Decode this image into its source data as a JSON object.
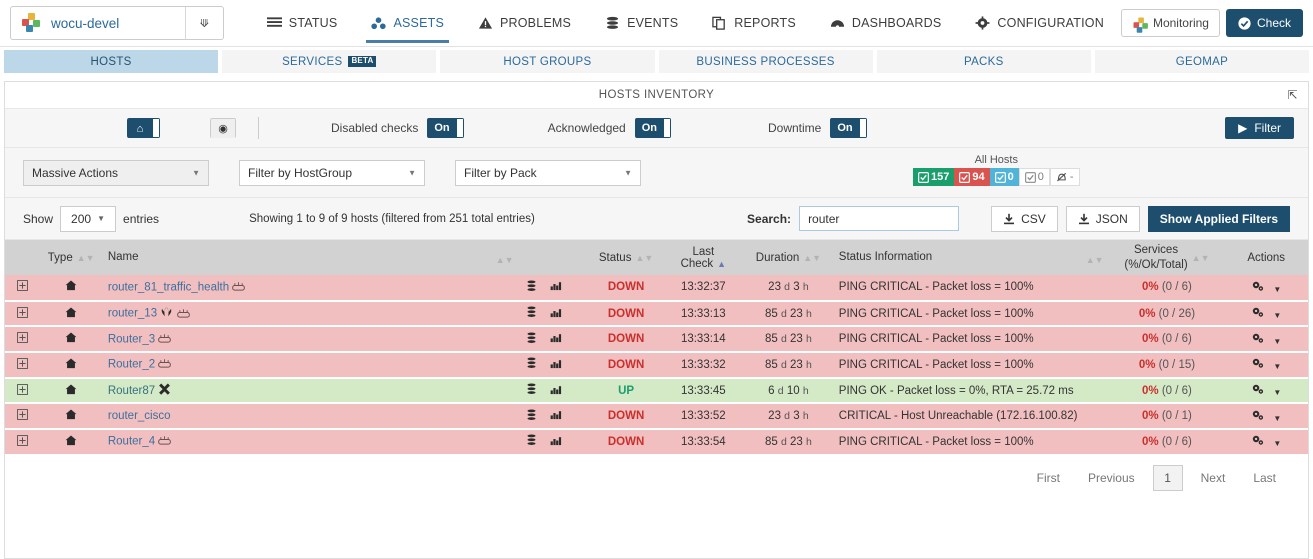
{
  "topnav": {
    "org_name": "wocu-devel",
    "items": [
      {
        "label": "STATUS",
        "icon": "list-icon",
        "active": false
      },
      {
        "label": "ASSETS",
        "icon": "assets-icon",
        "active": true
      },
      {
        "label": "PROBLEMS",
        "icon": "warning-triangle-icon",
        "active": false
      },
      {
        "label": "EVENTS",
        "icon": "stack-icon",
        "active": false
      },
      {
        "label": "REPORTS",
        "icon": "copy-icon",
        "active": false
      },
      {
        "label": "DASHBOARDS",
        "icon": "dashboard-icon",
        "active": false
      },
      {
        "label": "CONFIGURATION",
        "icon": "gear-icon",
        "active": false
      }
    ],
    "monitoring_label": "Monitoring",
    "check_label": "Check"
  },
  "tabs": [
    {
      "label": "HOSTS",
      "active": true,
      "badge": null
    },
    {
      "label": "SERVICES",
      "active": false,
      "badge": "BETA"
    },
    {
      "label": "HOST GROUPS",
      "active": false,
      "badge": null
    },
    {
      "label": "BUSINESS PROCESSES",
      "active": false,
      "badge": null
    },
    {
      "label": "PACKS",
      "active": false,
      "badge": null
    },
    {
      "label": "GEOMAP",
      "active": false,
      "badge": null
    }
  ],
  "panel": {
    "title": "HOSTS INVENTORY"
  },
  "toggles": {
    "disabled_checks": {
      "label": "Disabled checks",
      "value": "On"
    },
    "acknowledged": {
      "label": "Acknowledged",
      "value": "On"
    },
    "downtime": {
      "label": "Downtime",
      "value": "On"
    },
    "filter_button": "Filter"
  },
  "filters": {
    "massive_actions": "Massive Actions",
    "hostgroup": "Filter by HostGroup",
    "pack": "Filter by Pack"
  },
  "all_hosts": {
    "title": "All Hosts",
    "badges": [
      {
        "value": "157",
        "color": "#1a9e6c",
        "style": "green"
      },
      {
        "value": "94",
        "color": "#d9534f",
        "style": "red"
      },
      {
        "value": "0",
        "color": "#4fb4d8",
        "style": "blue"
      },
      {
        "value": "0",
        "color": "#ffffff",
        "style": "white"
      },
      {
        "value": "-",
        "color": "#ffffff",
        "style": "white"
      }
    ]
  },
  "controls": {
    "show_label": "Show",
    "entries_value": "200",
    "entries_label": "entries",
    "showing_text": "Showing 1 to 9 of 9 hosts (filtered from 251 total entries)",
    "search_label": "Search:",
    "search_value": "router",
    "csv_label": "CSV",
    "json_label": "JSON",
    "applied_filters_label": "Show Applied Filters"
  },
  "table": {
    "headers": {
      "type": "Type",
      "name": "Name",
      "status": "Status",
      "last_check": "Last Check",
      "duration": "Duration",
      "status_information": "Status Information",
      "services_line1": "Services",
      "services_line2": "(%/Ok/Total)",
      "actions": "Actions"
    },
    "rows": [
      {
        "name": "router_81_traffic_health",
        "extra_icons": [
          "router-device-icon"
        ],
        "status": "DOWN",
        "state": "down",
        "last_check": "13:32:37",
        "duration_days": "23",
        "duration_hours": "3",
        "status_information": "PING CRITICAL - Packet loss = 100%",
        "services_pct": "0%",
        "services_detail": "(0 / 6)"
      },
      {
        "name": "router_13",
        "extra_icons": [
          "huawei-icon",
          "router-device-icon"
        ],
        "status": "DOWN",
        "state": "down",
        "last_check": "13:33:13",
        "duration_days": "85",
        "duration_hours": "23",
        "status_information": "PING CRITICAL - Packet loss = 100%",
        "services_pct": "0%",
        "services_detail": "(0 / 26)"
      },
      {
        "name": "Router_3",
        "extra_icons": [
          "router-device-icon"
        ],
        "status": "DOWN",
        "state": "down",
        "last_check": "13:33:14",
        "duration_days": "85",
        "duration_hours": "23",
        "status_information": "PING CRITICAL - Packet loss = 100%",
        "services_pct": "0%",
        "services_detail": "(0 / 6)"
      },
      {
        "name": "Router_2",
        "extra_icons": [
          "router-device-icon"
        ],
        "status": "DOWN",
        "state": "down",
        "last_check": "13:33:32",
        "duration_days": "85",
        "duration_hours": "23",
        "status_information": "PING CRITICAL - Packet loss = 100%",
        "services_pct": "0%",
        "services_detail": "(0 / 15)"
      },
      {
        "name": "Router87",
        "extra_icons": [
          "juniper-icon"
        ],
        "status": "UP",
        "state": "up",
        "last_check": "13:33:45",
        "duration_days": "6",
        "duration_hours": "10",
        "status_information": "PING OK - Packet loss = 0%, RTA = 25.72 ms",
        "services_pct": "0%",
        "services_detail": "(0 / 6)"
      },
      {
        "name": "router_cisco",
        "extra_icons": [],
        "status": "DOWN",
        "state": "down",
        "last_check": "13:33:52",
        "duration_days": "23",
        "duration_hours": "3",
        "status_information": "CRITICAL - Host Unreachable (172.16.100.82)",
        "services_pct": "0%",
        "services_detail": "(0 / 1)"
      },
      {
        "name": "Router_4",
        "extra_icons": [
          "router-device-icon"
        ],
        "status": "DOWN",
        "state": "down",
        "last_check": "13:33:54",
        "duration_days": "85",
        "duration_hours": "23",
        "status_information": "PING CRITICAL - Packet loss = 100%",
        "services_pct": "0%",
        "services_detail": "(0 / 6)"
      }
    ],
    "duration_unit_day": "d",
    "duration_unit_hour": "h"
  },
  "pagination": {
    "first": "First",
    "previous": "Previous",
    "current": "1",
    "next": "Next",
    "last": "Last"
  }
}
